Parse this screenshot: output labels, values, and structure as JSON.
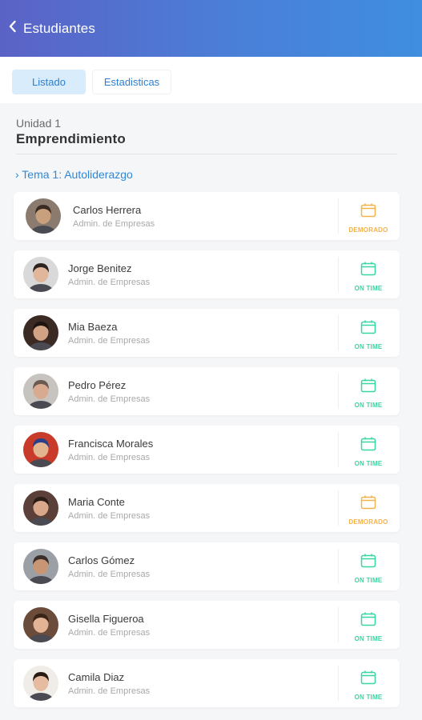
{
  "header": {
    "title": "Estudiantes"
  },
  "tabs": [
    {
      "label": "Listado",
      "active": true
    },
    {
      "label": "Estadisticas",
      "active": false
    }
  ],
  "unit": {
    "label": "Unidad 1",
    "title": "Emprendimiento"
  },
  "topic": {
    "label": "› Tema 1: Autoliderazgo"
  },
  "colors": {
    "accent": "#2d88d8",
    "late": "#f3b24a",
    "on_time": "#38d6a3"
  },
  "students": [
    {
      "name": "Carlos Herrera",
      "career": "Admin. de Empresas",
      "status": "DEMORADO",
      "status_type": "late"
    },
    {
      "name": "Jorge Benitez",
      "career": "Admin. de Empresas",
      "status": "ON TIME",
      "status_type": "ontime"
    },
    {
      "name": "Mia Baeza",
      "career": "Admin. de Empresas",
      "status": "ON TIME",
      "status_type": "ontime"
    },
    {
      "name": "Pedro Pérez",
      "career": "Admin. de Empresas",
      "status": "ON TIME",
      "status_type": "ontime"
    },
    {
      "name": "Francisca Morales",
      "career": "Admin. de Empresas",
      "status": "ON TIME",
      "status_type": "ontime"
    },
    {
      "name": "Maria Conte",
      "career": "Admin. de Empresas",
      "status": "DEMORADO",
      "status_type": "late"
    },
    {
      "name": "Carlos Gómez",
      "career": "Admin. de Empresas",
      "status": "ON TIME",
      "status_type": "ontime"
    },
    {
      "name": "Gisella Figueroa",
      "career": "Admin. de Empresas",
      "status": "ON TIME",
      "status_type": "ontime"
    },
    {
      "name": "Camila Diaz",
      "career": "Admin. de Empresas",
      "status": "ON TIME",
      "status_type": "ontime"
    }
  ]
}
